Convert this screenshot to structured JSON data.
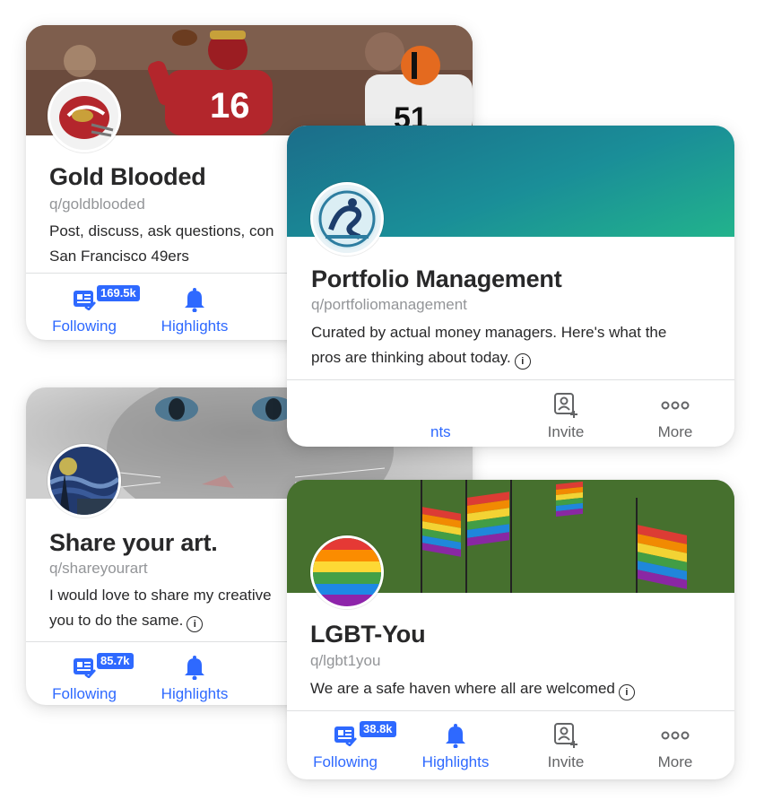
{
  "cards": {
    "gold": {
      "title": "Gold Blooded",
      "handle": "q/goldblooded",
      "desc_line1": "Post, discuss, ask questions, con",
      "desc_line2": "San Francisco 49ers",
      "follow_count": "169.5k",
      "following_label": "Following",
      "highlights_label": "Highlights"
    },
    "portfolio": {
      "title": "Portfolio Management",
      "handle": "q/portfoliomanagement",
      "desc_line1": "Curated by actual money managers. Here's what the",
      "desc_line2": "pros are thinking about today.",
      "info_glyph": "i",
      "partial_label": "nts",
      "invite_label": "Invite",
      "more_label": "More"
    },
    "art": {
      "title": "Share your art.",
      "handle": "q/shareyourart",
      "desc_line1": "I would love to share my creative",
      "desc_line2": "you to do the same.",
      "info_glyph": "i",
      "follow_count": "85.7k",
      "following_label": "Following",
      "highlights_label": "Highlights"
    },
    "lgbt": {
      "title": "LGBT-You",
      "handle": "q/lgbt1you",
      "desc_line1": "We are a safe haven where all are welcomed",
      "info_glyph": "i",
      "follow_count": "38.8k",
      "following_label": "Following",
      "highlights_label": "Highlights",
      "invite_label": "Invite",
      "more_label": "More"
    }
  },
  "colors": {
    "accent": "#2e69ff",
    "text": "#282829",
    "muted": "#939598",
    "teal_gradient_top": "#1d8c9a",
    "teal_gradient_bottom": "#1fa38f"
  },
  "icons": [
    "following-icon",
    "bell-icon",
    "invite-icon",
    "more-icon",
    "info-icon"
  ]
}
